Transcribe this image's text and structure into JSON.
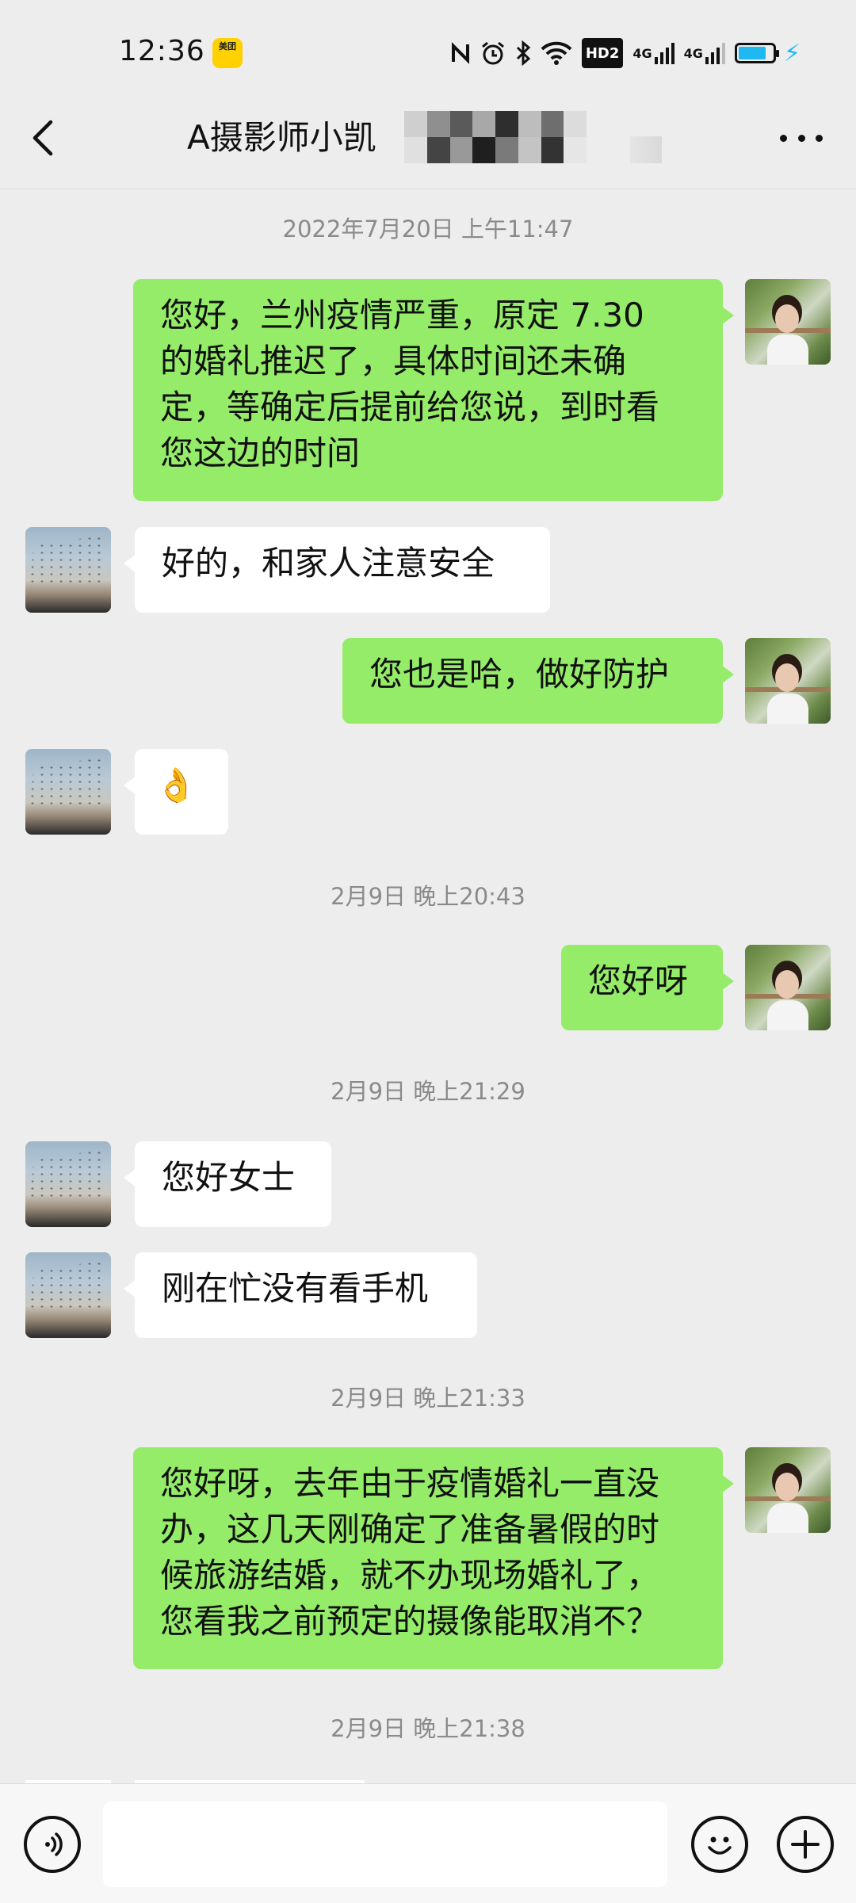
{
  "status_bar": {
    "time": "12:36",
    "app_badge": "美团",
    "hd_label": "HD2",
    "signal1": "4G",
    "signal2": "4G",
    "battery_percent": 80,
    "icons": [
      "nfc-icon",
      "alarm-icon",
      "bluetooth-icon",
      "wifi-icon",
      "hd-icon",
      "signal-icon",
      "signal-icon",
      "battery-icon",
      "charging-icon"
    ]
  },
  "header": {
    "title": "A摄影师小凯",
    "back_icon": "chevron-left-icon",
    "more_icon": "more-dots-icon"
  },
  "messages": [
    {
      "type": "time",
      "text": "2022年7月20日 上午11:47"
    },
    {
      "type": "me",
      "lines": [
        "您好，兰州疫情严重，原定 7.30",
        "的婚礼推迟了，具体时间还未确",
        "定，等确定后提前给您说，到时看",
        "您这边的时间"
      ]
    },
    {
      "type": "them",
      "text": "好的，和家人注意安全"
    },
    {
      "type": "me",
      "text": "您也是哈，做好防护"
    },
    {
      "type": "them",
      "text": "👌"
    },
    {
      "type": "time",
      "text": "2月9日 晚上20:43"
    },
    {
      "type": "me",
      "text": "您好呀"
    },
    {
      "type": "time",
      "text": "2月9日 晚上21:29"
    },
    {
      "type": "them",
      "text": "您好女士"
    },
    {
      "type": "them",
      "text": "刚在忙没有看手机"
    },
    {
      "type": "time",
      "text": "2月9日 晚上21:33"
    },
    {
      "type": "me",
      "lines": [
        "您好呀，去年由于疫情婚礼一直没",
        "办，这几天刚确定了准备暑假的时",
        "候旅游结婚，就不办现场婚礼了，",
        "您看我之前预定的摄像能取消不？"
      ]
    },
    {
      "type": "time",
      "text": "2月9日 晚上21:38"
    }
  ],
  "input_bar": {
    "voice_icon": "voice-icon",
    "emoji_icon": "emoji-icon",
    "plus_icon": "plus-icon",
    "input_value": ""
  },
  "colors": {
    "background": "#ededed",
    "my_bubble": "#95ec69",
    "their_bubble": "#ffffff",
    "timestamp": "#8a8a8a",
    "battery": "#20b8f0"
  }
}
